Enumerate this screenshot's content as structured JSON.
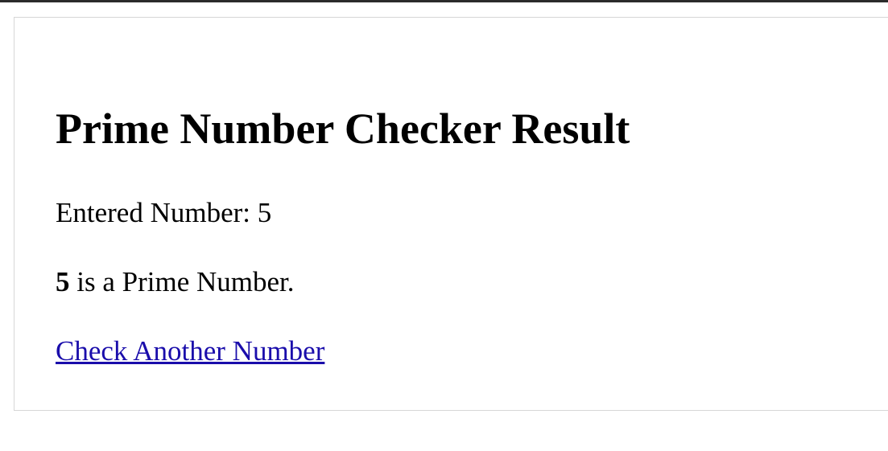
{
  "result": {
    "title": "Prime Number Checker Result",
    "entered_label": "Entered Number:",
    "entered_value": "5",
    "verdict_number": "5",
    "verdict_text": "is a Prime Number.",
    "link_label": "Check Another Number"
  },
  "colors": {
    "link": "#1a0dab",
    "card_border": "#d6d6d6",
    "top_strip": "#2b2b2b"
  }
}
